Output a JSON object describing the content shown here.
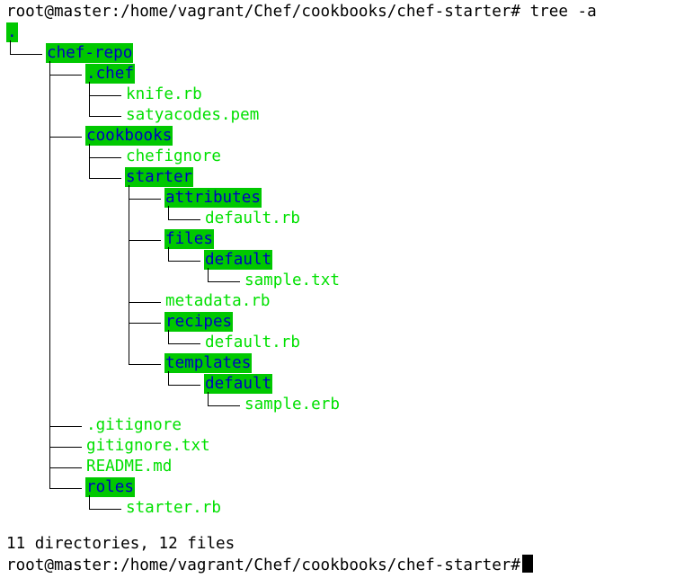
{
  "terminal": {
    "prompt": "root@master:/home/vagrant/Chef/cookbooks/chef-starter#",
    "command": " tree -a",
    "summary": "11 directories, 12 files",
    "colors": {
      "background": "#ffffff",
      "text": "#000000",
      "dir_bg": "#00c800",
      "dir_text": "#0000c0",
      "file_text": "#00e000"
    }
  },
  "tree": [
    {
      "name": ".",
      "depth": 0,
      "type": "dir"
    },
    {
      "name": "chef-repo",
      "depth": 1,
      "type": "dir"
    },
    {
      "name": ".chef",
      "depth": 2,
      "type": "dir"
    },
    {
      "name": "knife.rb",
      "depth": 3,
      "type": "file"
    },
    {
      "name": "satyacodes.pem",
      "depth": 3,
      "type": "file"
    },
    {
      "name": "cookbooks",
      "depth": 2,
      "type": "dir"
    },
    {
      "name": "chefignore",
      "depth": 3,
      "type": "file"
    },
    {
      "name": "starter",
      "depth": 3,
      "type": "dir"
    },
    {
      "name": "attributes",
      "depth": 4,
      "type": "dir"
    },
    {
      "name": "default.rb",
      "depth": 5,
      "type": "file"
    },
    {
      "name": "files",
      "depth": 4,
      "type": "dir"
    },
    {
      "name": "default",
      "depth": 5,
      "type": "dir"
    },
    {
      "name": "sample.txt",
      "depth": 6,
      "type": "file"
    },
    {
      "name": "metadata.rb",
      "depth": 4,
      "type": "file"
    },
    {
      "name": "recipes",
      "depth": 4,
      "type": "dir"
    },
    {
      "name": "default.rb",
      "depth": 5,
      "type": "file"
    },
    {
      "name": "templates",
      "depth": 4,
      "type": "dir"
    },
    {
      "name": "default",
      "depth": 5,
      "type": "dir"
    },
    {
      "name": "sample.erb",
      "depth": 6,
      "type": "file"
    },
    {
      "name": ".gitignore",
      "depth": 2,
      "type": "file"
    },
    {
      "name": "gitignore.txt",
      "depth": 2,
      "type": "file"
    },
    {
      "name": "README.md",
      "depth": 2,
      "type": "file"
    },
    {
      "name": "roles",
      "depth": 2,
      "type": "dir"
    },
    {
      "name": "starter.rb",
      "depth": 3,
      "type": "file"
    }
  ]
}
